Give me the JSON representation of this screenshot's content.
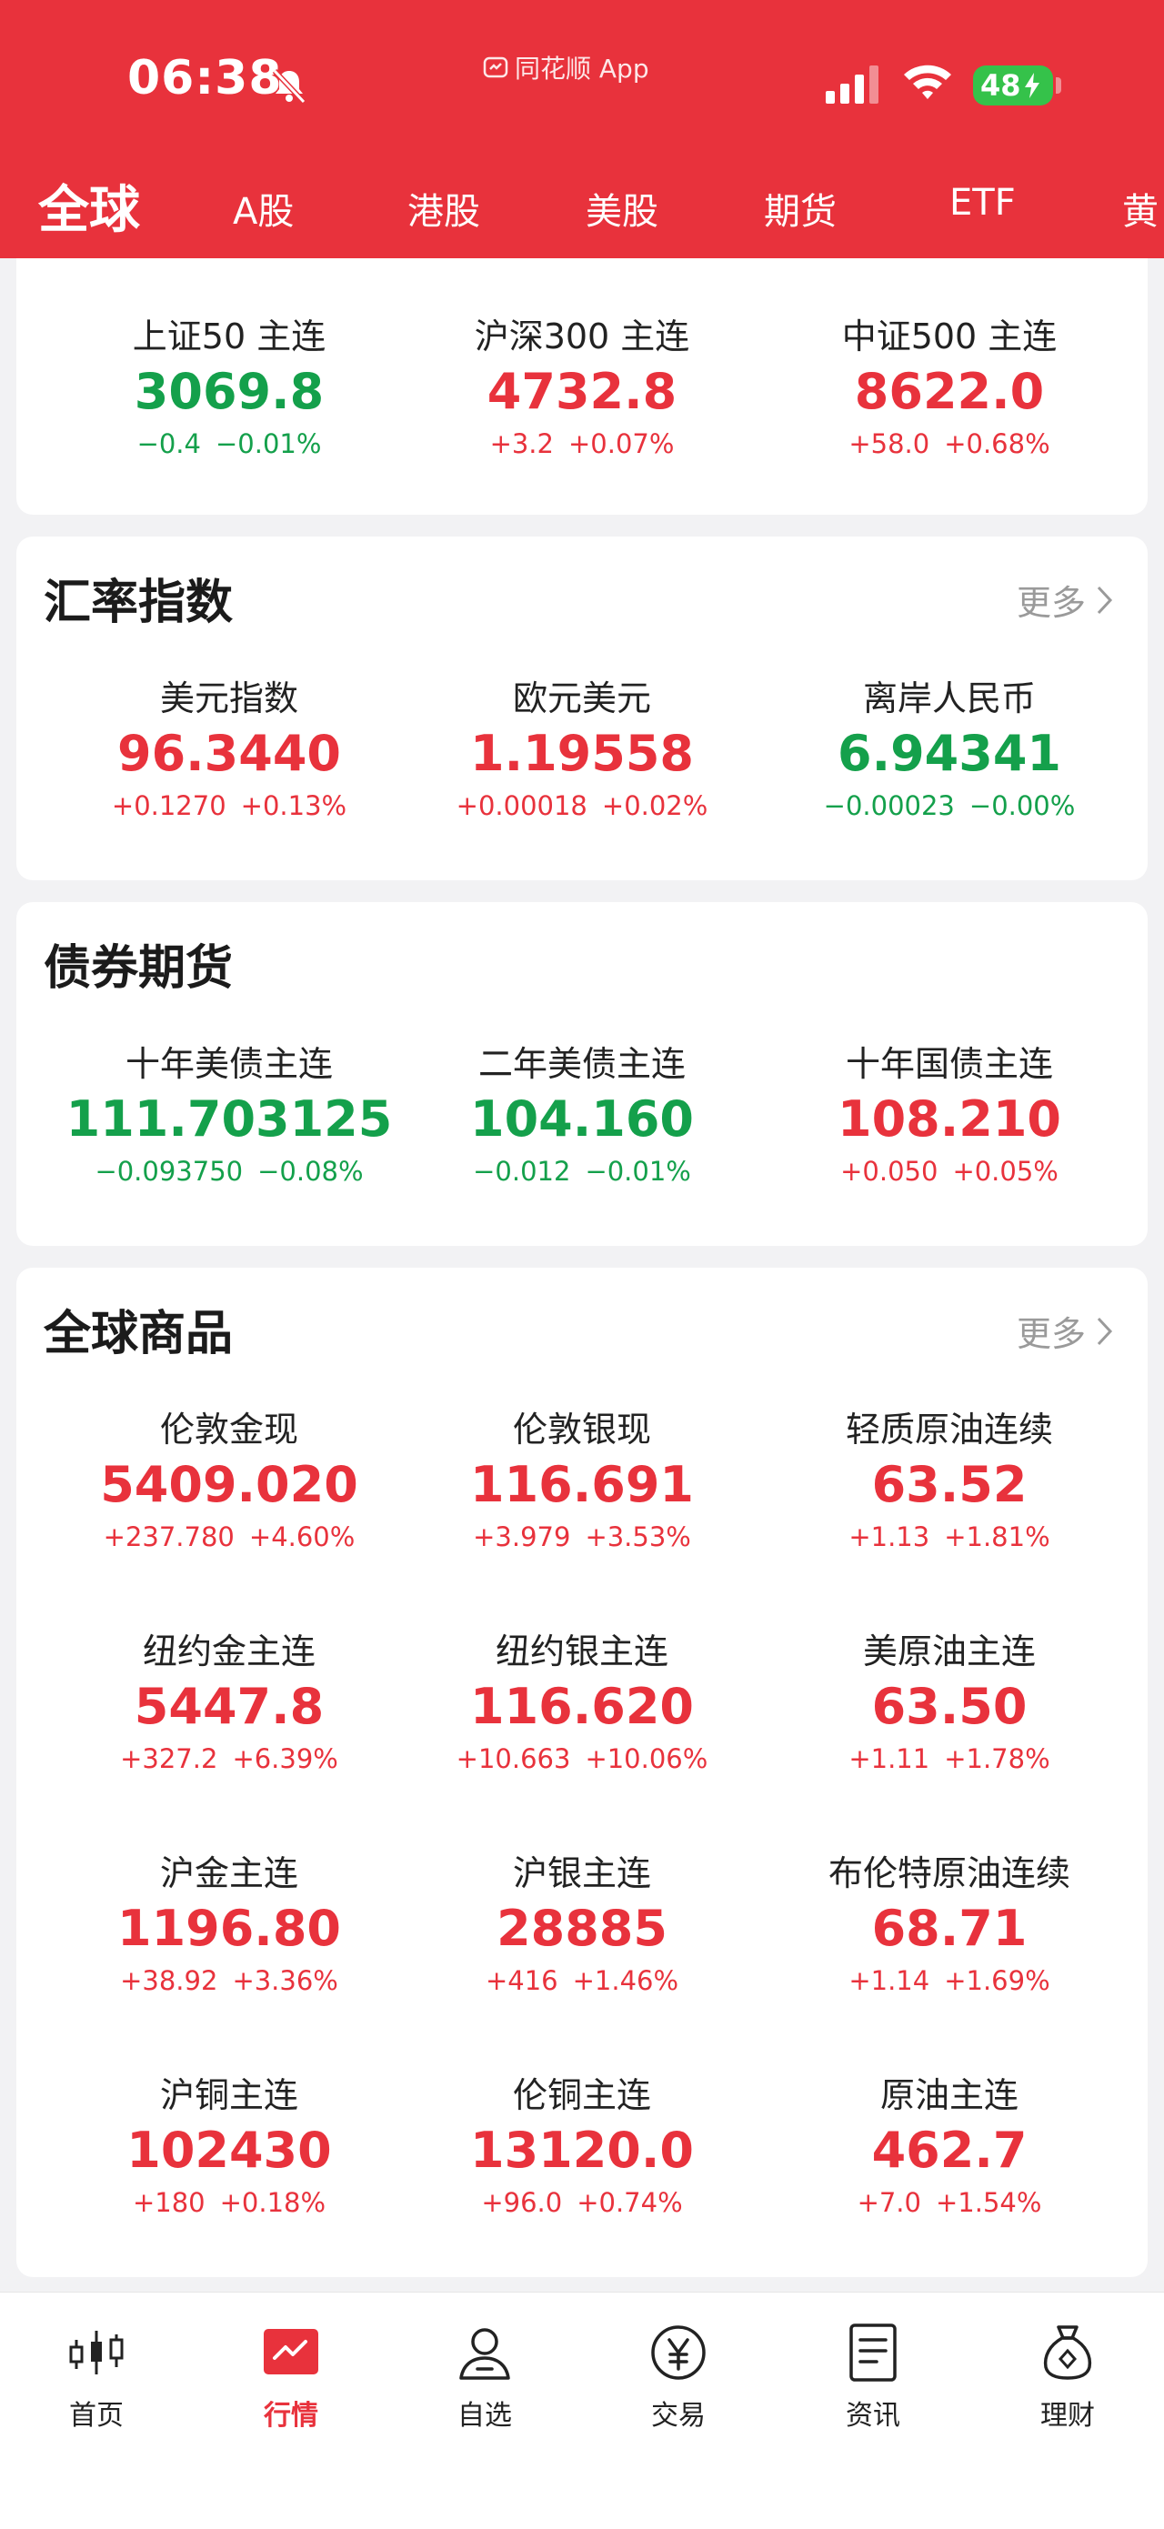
{
  "status_bar": {
    "time": "06:38",
    "app_name": "同花顺 App",
    "battery": "48"
  },
  "tabs": [
    "全球",
    "A股",
    "港股",
    "美股",
    "期货",
    "ETF",
    "黄"
  ],
  "active_tab": "全球",
  "sections": {
    "index_futures": {
      "items": [
        {
          "name": "上证50 主连",
          "price": "3069.8",
          "change": "−0.4",
          "pct": "−0.01%",
          "dir": "down"
        },
        {
          "name": "沪深300 主连",
          "price": "4732.8",
          "change": "+3.2",
          "pct": "+0.07%",
          "dir": "up"
        },
        {
          "name": "中证500 主连",
          "price": "8622.0",
          "change": "+58.0",
          "pct": "+0.68%",
          "dir": "up"
        }
      ]
    },
    "fx": {
      "title": "汇率指数",
      "more": "更多",
      "items": [
        {
          "name": "美元指数",
          "price": "96.3440",
          "change": "+0.1270",
          "pct": "+0.13%",
          "dir": "up"
        },
        {
          "name": "欧元美元",
          "price": "1.19558",
          "change": "+0.00018",
          "pct": "+0.02%",
          "dir": "up"
        },
        {
          "name": "离岸人民币",
          "price": "6.94341",
          "change": "−0.00023",
          "pct": "−0.00%",
          "dir": "down"
        }
      ]
    },
    "bonds": {
      "title": "债券期货",
      "items": [
        {
          "name": "十年美债主连",
          "price": "111.703125",
          "change": "−0.093750",
          "pct": "−0.08%",
          "dir": "down"
        },
        {
          "name": "二年美债主连",
          "price": "104.160",
          "change": "−0.012",
          "pct": "−0.01%",
          "dir": "down"
        },
        {
          "name": "十年国债主连",
          "price": "108.210",
          "change": "+0.050",
          "pct": "+0.05%",
          "dir": "up"
        }
      ]
    },
    "commodities": {
      "title": "全球商品",
      "more": "更多",
      "items": [
        {
          "name": "伦敦金现",
          "price": "5409.020",
          "change": "+237.780",
          "pct": "+4.60%",
          "dir": "up"
        },
        {
          "name": "伦敦银现",
          "price": "116.691",
          "change": "+3.979",
          "pct": "+3.53%",
          "dir": "up"
        },
        {
          "name": "轻质原油连续",
          "price": "63.52",
          "change": "+1.13",
          "pct": "+1.81%",
          "dir": "up"
        },
        {
          "name": "纽约金主连",
          "price": "5447.8",
          "change": "+327.2",
          "pct": "+6.39%",
          "dir": "up"
        },
        {
          "name": "纽约银主连",
          "price": "116.620",
          "change": "+10.663",
          "pct": "+10.06%",
          "dir": "up"
        },
        {
          "name": "美原油主连",
          "price": "63.50",
          "change": "+1.11",
          "pct": "+1.78%",
          "dir": "up"
        },
        {
          "name": "沪金主连",
          "price": "1196.80",
          "change": "+38.92",
          "pct": "+3.36%",
          "dir": "up"
        },
        {
          "name": "沪银主连",
          "price": "28885",
          "change": "+416",
          "pct": "+1.46%",
          "dir": "up"
        },
        {
          "name": "布伦特原油连续",
          "price": "68.71",
          "change": "+1.14",
          "pct": "+1.69%",
          "dir": "up"
        },
        {
          "name": "沪铜主连",
          "price": "102430",
          "change": "+180",
          "pct": "+0.18%",
          "dir": "up"
        },
        {
          "name": "伦铜主连",
          "price": "13120.0",
          "change": "+96.0",
          "pct": "+0.74%",
          "dir": "up"
        },
        {
          "name": "原油主连",
          "price": "462.7",
          "change": "+7.0",
          "pct": "+1.54%",
          "dir": "up"
        }
      ]
    }
  },
  "bottom_nav": [
    {
      "label": "首页",
      "icon": "candlestick-icon"
    },
    {
      "label": "行情",
      "icon": "market-chart-icon"
    },
    {
      "label": "自选",
      "icon": "person-icon"
    },
    {
      "label": "交易",
      "icon": "yuan-coin-icon"
    },
    {
      "label": "资讯",
      "icon": "news-document-icon"
    },
    {
      "label": "理财",
      "icon": "money-bag-icon"
    }
  ],
  "active_nav": "行情",
  "colors": {
    "brand_red": "#e8323c",
    "up": "#e8323c",
    "down": "#14a04b",
    "battery_green": "#35c24a"
  }
}
